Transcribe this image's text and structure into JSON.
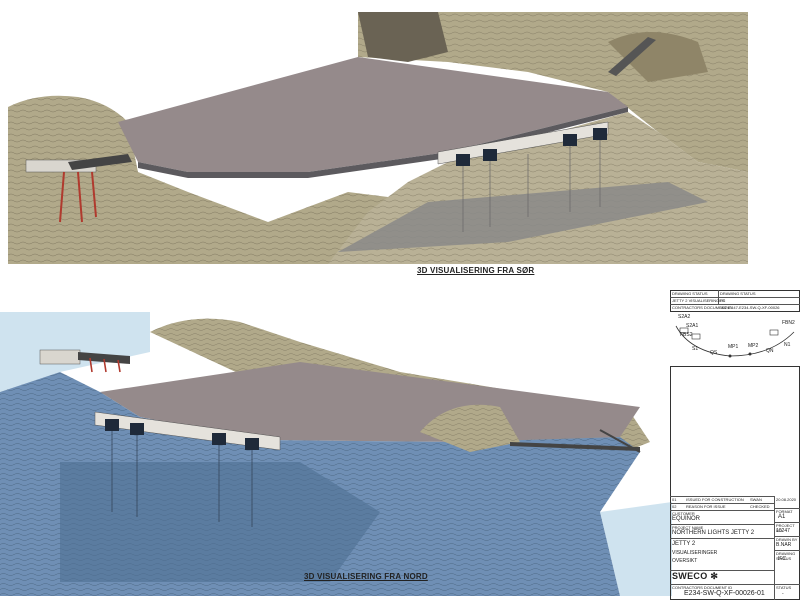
{
  "views": {
    "top": {
      "caption": "3D VISUALISERING FRA SØR"
    },
    "bottom": {
      "caption": "3D VISUALISERING FRA NORD"
    }
  },
  "key_plan": {
    "labels": [
      "S2A2",
      "S2A1",
      "FBS2",
      "S1",
      "QS",
      "MP1",
      "MP2",
      "QN",
      "FBN2",
      "N1"
    ],
    "header_left_1": "DRAWING STATUS",
    "header_left_2": "JETTY 2 VISUALISERINGER",
    "header_right_1": "DRAWING STATUS",
    "header_right_2": "FC",
    "contractor_label": "CONTRACTORS DOCUMENT ID",
    "contractor_id": "10247447-E234-SW-Q-XF-00026"
  },
  "title_block": {
    "revision_rows": [
      {
        "rev": "01",
        "text": "ISSUED FOR CONSTRUCTION",
        "by": "SWAN"
      },
      {
        "rev": "02",
        "text": "REASON FOR ISSUE",
        "by": "CHECKED"
      }
    ],
    "customer_label": "CUSTOMER",
    "customer": "EQUINOR",
    "project_label": "PROJECT NAME",
    "project": "NORTHERN LIGHTS JETTY 2",
    "title_1": "JETTY 2",
    "title_2": "VISUALISERINGER",
    "title_3": "OVERSIKT",
    "company_logo": "SWECO",
    "contractor_label": "CONTRACTORS DOCUMENT ID",
    "document_id": "E234-SW-Q-XF-00026-01",
    "side_fields": [
      {
        "label": "FORMAT",
        "value": "A1"
      },
      {
        "label": "PROJECT NO.",
        "value": "10247"
      },
      {
        "label": "DRAWN BY",
        "value": "B.NAR"
      },
      {
        "label": "DRAWING STATUS",
        "value": "IFC"
      }
    ],
    "status_label": "STATUS",
    "status_value": "-",
    "date_text": "20.08.2020"
  },
  "colors": {
    "rock": "#b1a98a",
    "rock_dark": "#8f8568",
    "quay": "#958a8b",
    "water": "#6f8fb5",
    "water_light": "#cfe3ef",
    "steel_red": "#b03a2e"
  }
}
